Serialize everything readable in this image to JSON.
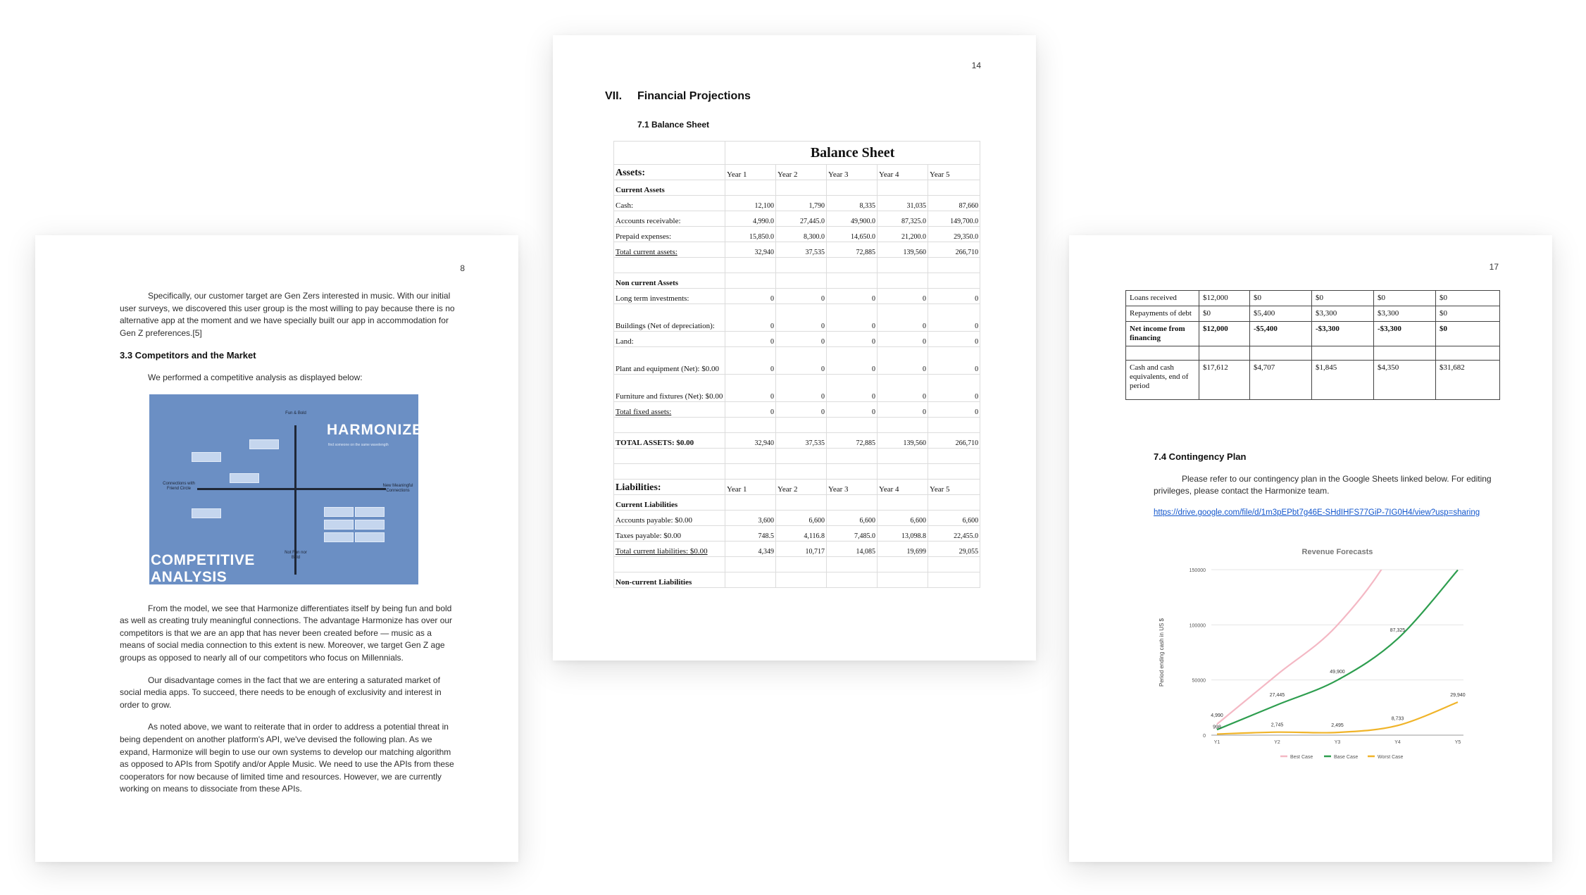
{
  "left_page": {
    "page_number": "8",
    "paragraph_1": "Specifically, our customer target are Gen Zers interested in music. With our initial user surveys, we discovered this user group is the most willing to pay because there is no alternative app at the moment and we have specially built our app in accommodation for Gen Z preferences.[5]",
    "heading": "3.3 Competitors and the Market",
    "paragraph_2": "We performed a competitive analysis as displayed below:",
    "figure": {
      "brand": "HARMONIZE",
      "brand_tagline": "find someone on the same wavelength",
      "title_line1": "COMPETITIVE",
      "title_line2": "ANALYSIS",
      "axis_top": "Fun & Bold",
      "axis_bottom": "Not Fun nor Bold",
      "axis_left": "Connections with Friend Circle",
      "axis_right": "New Meaningful Connections"
    },
    "paragraph_3": "From the model, we see that Harmonize differentiates itself by being fun and bold as well as creating truly meaningful connections. The advantage Harmonize has over our competitors is that we are an app that has never been created before — music as a means of social media connection to this extent is new. Moreover, we target Gen Z age groups as opposed to nearly all of our competitors who focus on Millennials.",
    "paragraph_4": "Our disadvantage comes in the fact that we are entering a saturated market of social media apps. To succeed, there needs to be enough of exclusivity and interest in order to grow.",
    "paragraph_5": "As noted above, we want to reiterate that in order to address a potential threat in being dependent on another platform's API, we've devised the following plan. As we expand, Harmonize will begin to use our own systems to develop our matching algorithm as opposed to APIs from Spotify and/or Apple Music. We need to use the APIs from these cooperators for now because of limited time and resources. However, we are currently working on means to dissociate from these APIs."
  },
  "middle_page": {
    "page_number": "14",
    "section_number": "VII.",
    "section_title": "Financial Projections",
    "subsection_title": "7.1 Balance Sheet",
    "table_title": "Balance Sheet",
    "years": [
      "Year 1",
      "Year 2",
      "Year 3",
      "Year 4",
      "Year 5"
    ],
    "assets_label": "Assets:",
    "current_assets_label": "Current Assets",
    "current_assets": [
      {
        "label": "Cash:",
        "values": [
          "12,100",
          "1,790",
          "8,335",
          "31,035",
          "87,660"
        ]
      },
      {
        "label": "Accounts receivable:",
        "values": [
          "4,990.0",
          "27,445.0",
          "49,900.0",
          "87,325.0",
          "149,700.0"
        ]
      },
      {
        "label": "Prepaid expenses:",
        "values": [
          "15,850.0",
          "8,300.0",
          "14,650.0",
          "21,200.0",
          "29,350.0"
        ]
      },
      {
        "label": "Total current assets:",
        "values": [
          "32,940",
          "37,535",
          "72,885",
          "139,560",
          "266,710"
        ]
      }
    ],
    "non_current_assets_label": "Non current Assets",
    "non_current_assets": [
      {
        "label": "Long term investments:",
        "values": [
          "0",
          "0",
          "0",
          "0",
          "0"
        ]
      },
      {
        "label": "Buildings (Net of depreciation):",
        "values": [
          "0",
          "0",
          "0",
          "0",
          "0"
        ]
      },
      {
        "label": "Land:",
        "values": [
          "0",
          "0",
          "0",
          "0",
          "0"
        ]
      },
      {
        "label": "Plant and equipment (Net): $0.00",
        "values": [
          "0",
          "0",
          "0",
          "0",
          "0"
        ]
      },
      {
        "label": "Furniture and fixtures (Net): $0.00",
        "values": [
          "0",
          "0",
          "0",
          "0",
          "0"
        ]
      },
      {
        "label": "Total fixed assets:",
        "values": [
          "0",
          "0",
          "0",
          "0",
          "0"
        ]
      }
    ],
    "total_assets": {
      "label": "TOTAL ASSETS: $0.00",
      "values": [
        "32,940",
        "37,535",
        "72,885",
        "139,560",
        "266,710"
      ]
    },
    "liabilities_label": "Liabilities:",
    "current_liabilities_label": "Current Liabilities",
    "current_liabilities": [
      {
        "label": "Accounts payable: $0.00",
        "values": [
          "3,600",
          "6,600",
          "6,600",
          "6,600",
          "6,600"
        ]
      },
      {
        "label": "Taxes payable: $0.00",
        "values": [
          "748.5",
          "4,116.8",
          "7,485.0",
          "13,098.8",
          "22,455.0"
        ]
      },
      {
        "label": "Total current liabilities: $0.00",
        "values": [
          "4,349",
          "10,717",
          "14,085",
          "19,699",
          "29,055"
        ]
      }
    ],
    "non_current_liabilities_label": "Non-current Liabilities"
  },
  "right_page": {
    "page_number": "17",
    "cashflow_rows": [
      {
        "label": "Loans received",
        "values": [
          "$12,000",
          "$0",
          "$0",
          "$0",
          "$0"
        ],
        "bold": false
      },
      {
        "label": "Repayments of debt",
        "values": [
          "$0",
          "$5,400",
          "$3,300",
          "$3,300",
          "$0"
        ],
        "bold": false
      },
      {
        "label": "Net income from financing",
        "values": [
          "$12,000",
          "-$5,400",
          "-$3,300",
          "-$3,300",
          "$0"
        ],
        "bold": true
      },
      {
        "label": "Cash and cash equivalents, end of period",
        "values": [
          "$17,612",
          "$4,707",
          "$1,845",
          "$4,350",
          "$31,682"
        ],
        "bold": false
      }
    ],
    "heading": "7.4 Contingency Plan",
    "paragraph": "Please refer to our contingency plan in the Google Sheets linked below. For editing privileges, please contact the Harmonize team.",
    "link": "https://drive.google.com/file/d/1m3pEPbt7g46E-SHdIHFS77GiP-7IG0H4/view?usp=sharing"
  },
  "chart_data": {
    "type": "line",
    "title": "Revenue Forecasts",
    "ylabel": "Period ending cash in US $",
    "xlabel": "",
    "categories": [
      "Y1",
      "Y2",
      "Y3",
      "Y4",
      "Y5"
    ],
    "ylim": [
      0,
      150000
    ],
    "yticks": [
      "0",
      "50000",
      "100000",
      "150000"
    ],
    "legend_position": "bottom",
    "grid": true,
    "series": [
      {
        "name": "Best Case",
        "color": "#f4b8c4",
        "values": [
          9980,
          54890,
          99800,
          174650,
          299400
        ]
      },
      {
        "name": "Base Case",
        "color": "#2e9e4f",
        "values": [
          4990,
          27445,
          49900,
          87325,
          149700
        ]
      },
      {
        "name": "Worst Case",
        "color": "#f0b429",
        "values": [
          998,
          2745,
          2495,
          8733,
          29940
        ]
      }
    ],
    "data_labels": [
      {
        "text": "4,990",
        "series": "Base Case",
        "index": 0,
        "dy": -18
      },
      {
        "text": "998",
        "series": "Worst Case",
        "index": 0,
        "dy": -8
      },
      {
        "text": "27,445",
        "series": "Base Case",
        "index": 1,
        "dy": -12
      },
      {
        "text": "2,745",
        "series": "Worst Case",
        "index": 1,
        "dy": -8
      },
      {
        "text": "49,900",
        "series": "Base Case",
        "index": 2,
        "dy": -10
      },
      {
        "text": "2,495",
        "series": "Worst Case",
        "index": 2,
        "dy": -8
      },
      {
        "text": "87,325",
        "series": "Base Case",
        "index": 3,
        "dy": -10
      },
      {
        "text": "8,733",
        "series": "Worst Case",
        "index": 3,
        "dy": -8
      },
      {
        "text": "29,940",
        "series": "Worst Case",
        "index": 4,
        "dy": -8
      }
    ]
  }
}
